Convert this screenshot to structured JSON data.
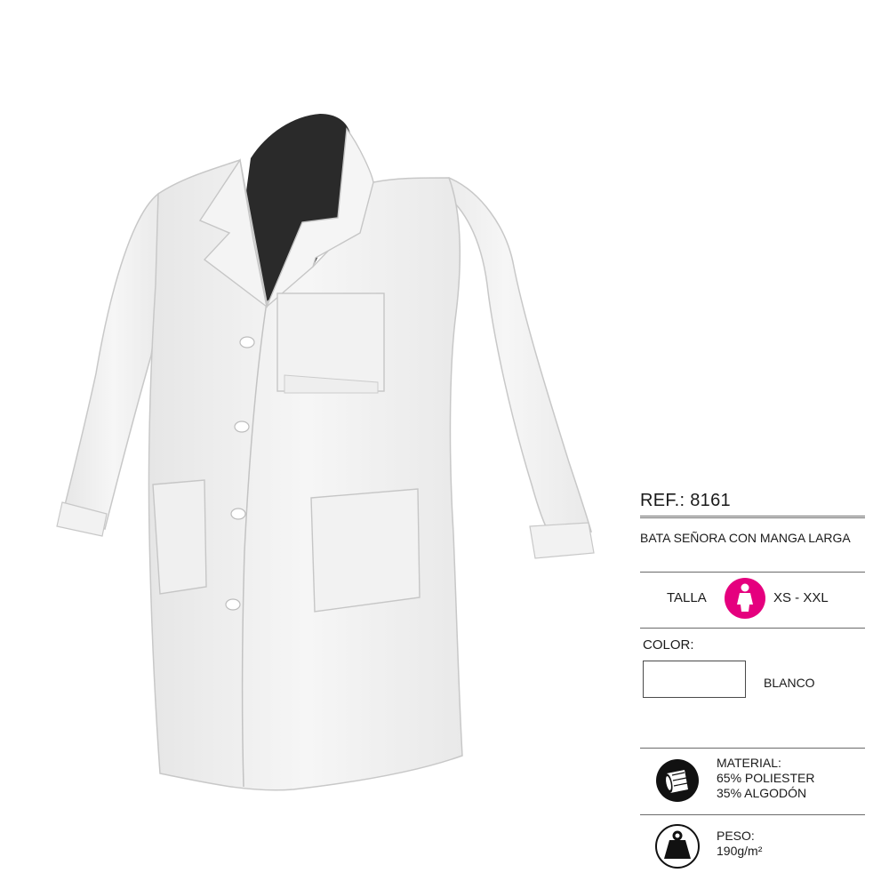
{
  "product": {
    "ref": "REF.: 8161",
    "description": "BATA SEÑORA CON MANGA LARGA",
    "size": {
      "label": "TALLA",
      "range": "XS - XXL",
      "icon": "woman-figure-icon"
    },
    "color": {
      "label": "COLOR:",
      "name": "BLANCO",
      "swatch": "#ffffff"
    },
    "material": {
      "label": "MATERIAL:",
      "lines": [
        "65% POLIESTER",
        "35% ALGODÓN"
      ],
      "icon": "fabric-roll-icon"
    },
    "weight": {
      "label": "PESO:",
      "value": "190g/m²",
      "icon": "weight-icon"
    }
  },
  "colors": {
    "accent": "#e5007e",
    "rule": "#6b6b6b",
    "mannequin": "#2a2a2a"
  }
}
